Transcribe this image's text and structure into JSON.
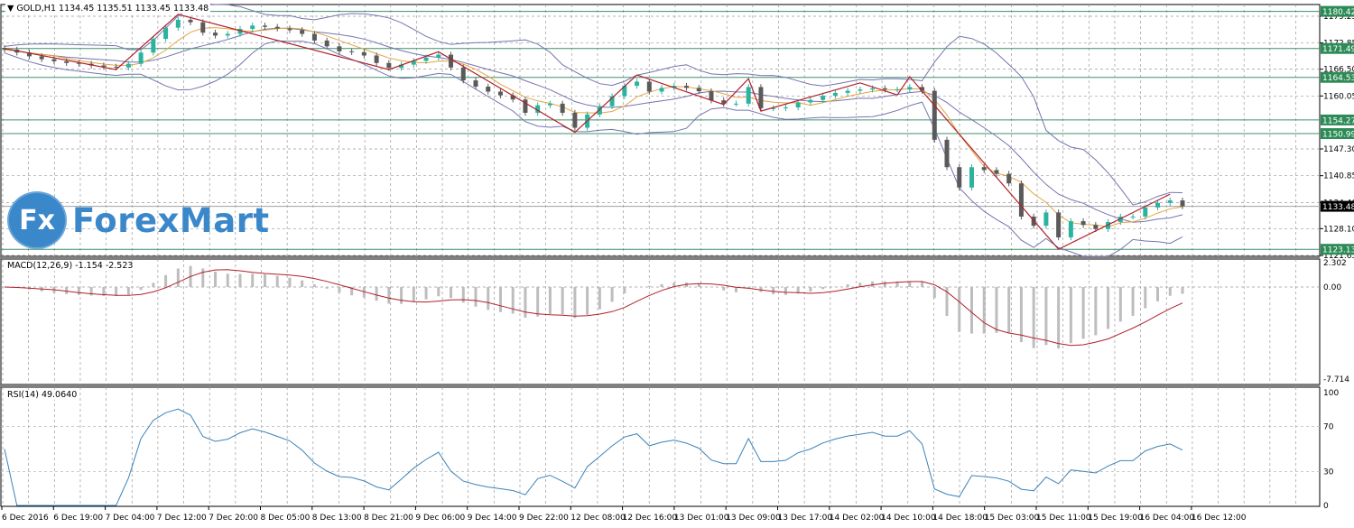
{
  "header": {
    "symbol": "GOLD,H1",
    "ohlc": "1134.45 1135.51 1133.45 1133.48",
    "menu_icon": "triangle-down-icon"
  },
  "logo": {
    "mark": "Fx",
    "word": "ForexMart"
  },
  "macd_label": "MACD(12,26,9) -1.154 -2.523",
  "rsi_label": "RSI(14) 49.0640",
  "colors": {
    "bull": "#2bb3a0",
    "bear": "#5a5a5a",
    "bollinger": "#7474b0",
    "ma": "#e3a543",
    "zigzag": "#b0202a",
    "level": "#3d8f6e",
    "level_tag": "#2e8b57",
    "macd_hist": "#bdbdbd",
    "macd_signal": "#b0202a",
    "rsi": "#3b82b9",
    "grid": "#9a9a9a",
    "current": "#000000"
  },
  "chart_data": [
    {
      "type": "candlestick",
      "symbol": "GOLD",
      "timeframe": "H1",
      "ylim": [
        1121.65,
        1179.25
      ],
      "y_ticks": [
        "1179.25",
        "1172.85",
        "1166.50",
        "1160.05",
        "1147.30",
        "1140.85",
        "1134.40",
        "1128.10",
        "1121.65"
      ],
      "x_ticks": [
        "6 Dec 2016",
        "6 Dec 19:00",
        "7 Dec 04:00",
        "7 Dec 12:00",
        "7 Dec 20:00",
        "8 Dec 05:00",
        "8 Dec 13:00",
        "8 Dec 21:00",
        "9 Dec 06:00",
        "9 Dec 14:00",
        "9 Dec 22:00",
        "12 Dec 08:00",
        "12 Dec 16:00",
        "13 Dec 01:00",
        "13 Dec 09:00",
        "13 Dec 17:00",
        "14 Dec 02:00",
        "14 Dec 10:00",
        "14 Dec 18:00",
        "15 Dec 03:00",
        "15 Dec 11:00",
        "15 Dec 19:00",
        "16 Dec 04:00",
        "16 Dec 12:00"
      ],
      "closes": [
        1171.2,
        1170.5,
        1169.6,
        1168.9,
        1168.4,
        1168.0,
        1167.8,
        1167.4,
        1167.1,
        1166.9,
        1167.8,
        1170.5,
        1173.8,
        1176.5,
        1178.4,
        1177.8,
        1175.3,
        1174.6,
        1175.0,
        1176.2,
        1177.0,
        1176.7,
        1176.3,
        1175.9,
        1175.0,
        1173.4,
        1172.0,
        1170.8,
        1170.6,
        1169.8,
        1168.0,
        1166.8,
        1167.6,
        1168.5,
        1169.3,
        1170.0,
        1166.9,
        1163.8,
        1162.3,
        1161.1,
        1160.2,
        1159.2,
        1156.0,
        1157.8,
        1158.2,
        1156.0,
        1152.4,
        1155.6,
        1157.6,
        1160.0,
        1162.5,
        1163.5,
        1161.1,
        1162.0,
        1162.5,
        1162.0,
        1161.2,
        1159.0,
        1158.2,
        1158.2,
        1162.2,
        1157.1,
        1157.1,
        1157.3,
        1158.5,
        1159.1,
        1160.1,
        1160.8,
        1161.3,
        1161.6,
        1161.9,
        1161.6,
        1161.6,
        1162.2,
        1161.3,
        1149.5,
        1142.9,
        1138.0,
        1142.9,
        1142.2,
        1141.3,
        1139.0,
        1131.0,
        1128.8,
        1132.0,
        1126.0,
        1129.9,
        1129.0,
        1128.0,
        1129.7,
        1131.0,
        1131.0,
        1133.2,
        1134.3,
        1134.9,
        1133.48
      ],
      "zigzag": [
        [
          0,
          1171.5
        ],
        [
          9,
          1166.4
        ],
        [
          14,
          1179.7
        ],
        [
          31,
          1166.4
        ],
        [
          35,
          1170.7
        ],
        [
          46,
          1151.3
        ],
        [
          51,
          1165.1
        ],
        [
          58,
          1158.0
        ],
        [
          60,
          1164.2
        ],
        [
          61,
          1156.4
        ],
        [
          69,
          1163.2
        ],
        [
          72,
          1160.3
        ],
        [
          73,
          1164.7
        ],
        [
          85,
          1123.13
        ],
        [
          94,
          1136.4
        ]
      ],
      "levels": [
        "1180.42",
        "1171.49",
        "1164.53",
        "1154.27",
        "1150.99",
        "1123.13"
      ],
      "current_price": "1133.48",
      "indicators": [
        "Bollinger Bands",
        "Moving Average",
        "ZigZag"
      ]
    },
    {
      "type": "bar+line",
      "name": "MACD(12,26,9)",
      "ylim": [
        -7.714,
        2.302
      ],
      "y_ticks": [
        "2.302",
        "0.00",
        "-7.714"
      ],
      "main": -1.154,
      "signal": -2.523
    },
    {
      "type": "line",
      "name": "RSI(14)",
      "ylim": [
        0,
        100
      ],
      "y_ticks": [
        "100",
        "70",
        "30",
        "0"
      ],
      "value": 49.064
    }
  ]
}
